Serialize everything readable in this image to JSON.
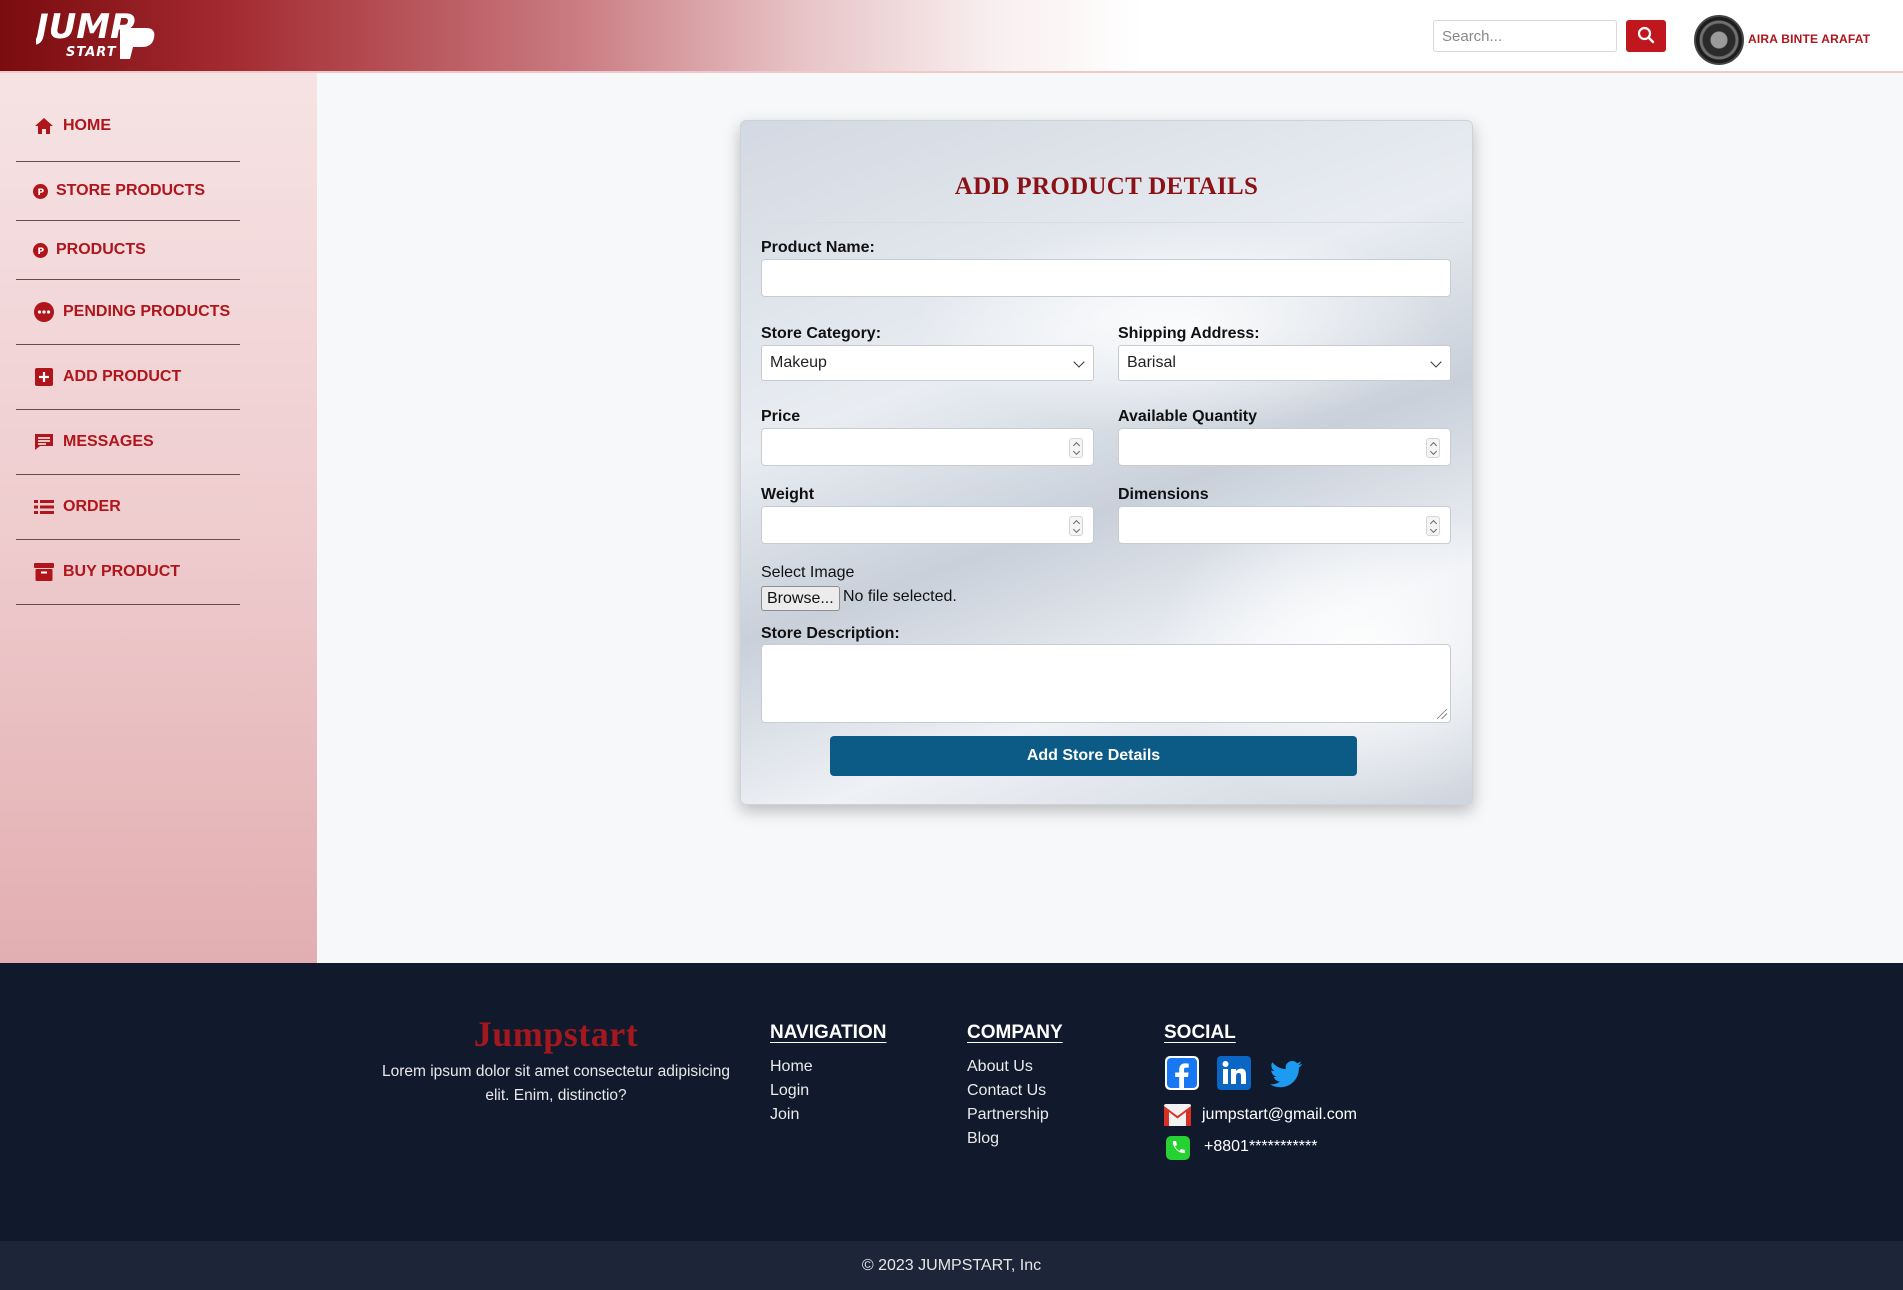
{
  "header": {
    "logo_text_top": "JUMP",
    "logo_text_bottom": "START",
    "search_placeholder": "Search...",
    "search_icon": "search-icon",
    "user_name": "AIRA BINTE ARAFAT",
    "brand_color": "#c0161e"
  },
  "sidebar": {
    "items": [
      {
        "label": "HOME",
        "icon": "home-icon"
      },
      {
        "label": "STORE PRODUCTS",
        "icon": "p-circle-icon"
      },
      {
        "label": "PRODUCTS",
        "icon": "p-circle-icon"
      },
      {
        "label": "PENDING PRODUCTS",
        "icon": "ellipsis-circle-icon"
      },
      {
        "label": "ADD PRODUCT",
        "icon": "plus-square-icon"
      },
      {
        "label": "MESSAGES",
        "icon": "message-icon"
      },
      {
        "label": "ORDER",
        "icon": "list-icon"
      },
      {
        "label": "BUY PRODUCT",
        "icon": "archive-box-icon"
      }
    ]
  },
  "form": {
    "title": "ADD PRODUCT DETAILS",
    "product_name_label": "Product Name:",
    "product_name_value": "",
    "store_category_label": "Store Category:",
    "store_category_value": "Makeup",
    "shipping_address_label": "Shipping Address:",
    "shipping_address_value": "Barisal",
    "price_label": "Price",
    "available_quantity_label": "Available Quantity",
    "weight_label": "Weight",
    "dimensions_label": "Dimensions",
    "select_image_label": "Select Image",
    "browse_label": "Browse...",
    "file_status": "No file selected.",
    "description_label": "Store Description:",
    "description_value": "",
    "submit_label": "Add Store Details",
    "submit_color": "#0c5a86"
  },
  "footer": {
    "brand": "Jumpstart",
    "description": "Lorem ipsum dolor sit amet consectetur adipisicing elit. Enim, distinctio?",
    "navigation_heading": "NAVIGATION",
    "navigation_links": [
      "Home",
      "Login",
      "Join"
    ],
    "company_heading": "COMPANY",
    "company_links": [
      "About Us",
      "Contact Us",
      "Partnership",
      "Blog"
    ],
    "social_heading": "SOCIAL",
    "social_icons": [
      "facebook-icon",
      "linkedin-icon",
      "twitter-icon"
    ],
    "email": "jumpstart@gmail.com",
    "phone": "+8801***********",
    "copyright": "© 2023 JUMPSTART, Inc",
    "background_color": "#111a2c"
  }
}
